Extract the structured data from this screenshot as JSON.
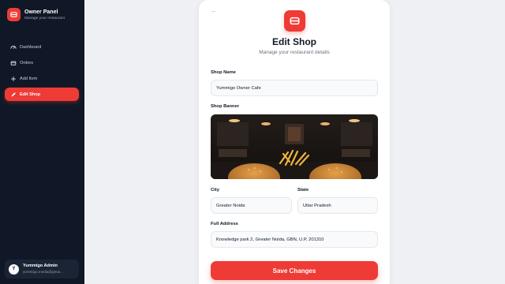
{
  "sidebar": {
    "brand_title": "Owner Panel",
    "brand_subtitle": "Manage your restaurant",
    "items": [
      {
        "label": "Dashboard",
        "icon": "gauge-icon"
      },
      {
        "label": "Orders",
        "icon": "box-icon"
      },
      {
        "label": "Add Item",
        "icon": "plus-icon"
      },
      {
        "label": "Edit Shop",
        "icon": "pencil-icon",
        "active": true
      }
    ],
    "user": {
      "initial": "Y",
      "name": "Yummigo Admin",
      "email": "yummigo.media@gmai..."
    }
  },
  "form": {
    "title": "Edit Shop",
    "subtitle": "Manage your restaurant details",
    "shop_name_label": "Shop Name",
    "shop_name_value": "Yummigo Owner Cafe",
    "banner_label": "Shop Banner",
    "city_label": "City",
    "city_value": "Greater Noida",
    "state_label": "State",
    "state_value": "Uttar Pradesh",
    "address_label": "Full Address",
    "address_value": "Knowledge park 2, Greater Noida, GBN, U.P, 201310",
    "save_label": "Save Changes"
  },
  "colors": {
    "accent": "#ef3b36",
    "sidebar_bg": "#101827",
    "page_bg": "#eef0f4"
  }
}
